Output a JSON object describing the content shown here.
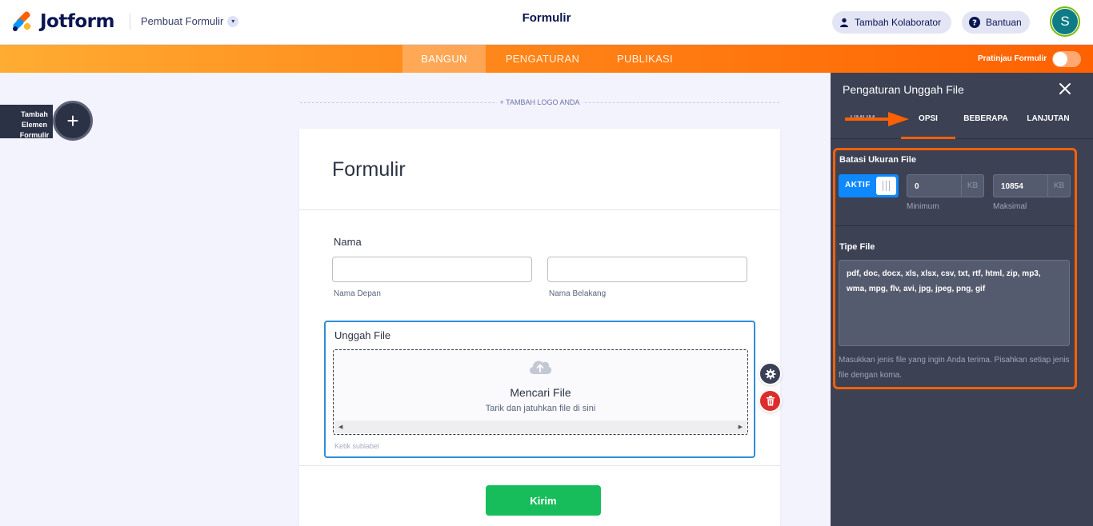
{
  "header": {
    "logo_text": "Jotform",
    "builder_menu": "Pembuat Formulir",
    "form_title": "Formulir",
    "collaborator_label": "Tambah Kolaborator",
    "help_label": "Bantuan",
    "avatar_initial": "S"
  },
  "navbar": {
    "tabs": [
      {
        "label": "BANGUN",
        "active": true
      },
      {
        "label": "PENGATURAN",
        "active": false
      },
      {
        "label": "PUBLIKASI",
        "active": false
      }
    ],
    "preview_label": "Pratinjau Formulir",
    "preview_on": false
  },
  "left": {
    "add_element_label": "Tambah\nElemen\nFormulir"
  },
  "canvas": {
    "add_logo": "+ TAMBAH LOGO ANDA",
    "title": "Formulir",
    "name_field": {
      "label": "Nama",
      "first_sublabel": "Nama Depan",
      "last_sublabel": "Nama Belakang"
    },
    "upload_field": {
      "label": "Unggah File",
      "dropzone_title": "Mencari File",
      "dropzone_sub": "Tarik dan jatuhkan file di sini",
      "sublabel_hint": "Ketik sublabel"
    },
    "submit_label": "Kirim"
  },
  "panel": {
    "title": "Pengaturan Unggah File",
    "tabs": [
      "UMUM",
      "OPSI",
      "BEBERAPA",
      "LANJUTAN"
    ],
    "active_tab": "OPSI",
    "size_limit": {
      "title": "Batasi Ukuran File",
      "toggle_label": "AKTIF",
      "min_value": "0",
      "max_value": "10854",
      "unit": "KB",
      "min_label": "Minimum",
      "max_label": "Maksimal"
    },
    "file_types": {
      "title": "Tipe File",
      "value": "pdf, doc, docx, xls, xlsx, csv, txt, rtf, html, zip, mp3, wma, mpg, flv, avi, jpg, jpeg, png, gif",
      "hint": "Masukkan jenis file yang ingin Anda terima. Pisahkan setiap jenis file dengan koma."
    }
  },
  "colors": {
    "brand_orange": "#ff6100",
    "panel_bg": "#3c4154",
    "toggle_blue": "#0e89ff",
    "submit_green": "#18bd5b",
    "delete_red": "#dd2c2c"
  }
}
